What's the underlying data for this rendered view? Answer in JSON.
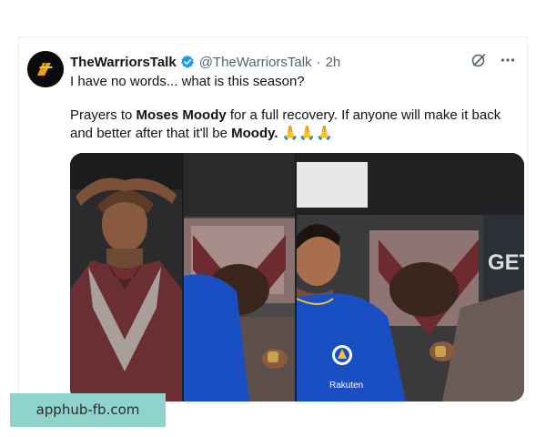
{
  "tweet": {
    "display_name": "TheWarriorsTalk",
    "handle": "@TheWarriorsTalk",
    "separator": "·",
    "time": "2h",
    "line1": "I have no words... what is this season?",
    "line2_a": "Prayers to ",
    "line2_b": "Moses Moody",
    "line2_c": " for a full recovery. If anyone will make it back and better after that it'll be ",
    "line2_d": "Moody.",
    "line2_e": " 🙏🙏🙏",
    "jersey_sponsor": "Rakuten",
    "sign_text": "GET"
  },
  "icons": {
    "verified": "verified-badge-icon",
    "grok": "grok-icon",
    "more": "more-options-icon"
  },
  "colors": {
    "verified": "#1d9bf0",
    "watermark_bg": "#8fd3cd",
    "jersey": "#1a4fc4"
  },
  "watermark": {
    "text": "apphub-fb.com"
  }
}
